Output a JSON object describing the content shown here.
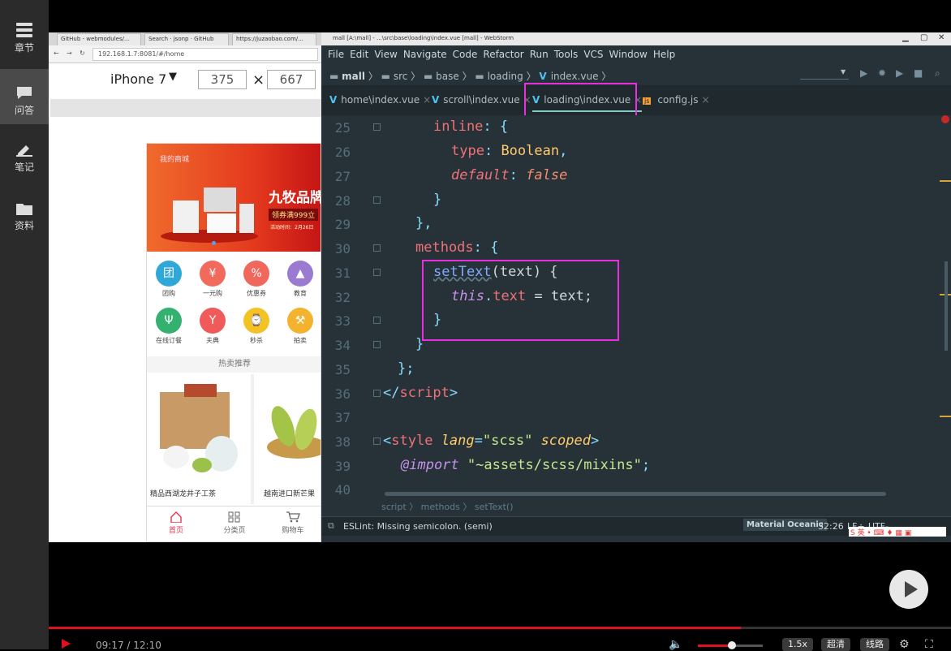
{
  "sidebar": {
    "items": [
      {
        "label": "章节",
        "icon": "list-icon"
      },
      {
        "label": "问答",
        "icon": "chat-icon"
      },
      {
        "label": "笔记",
        "icon": "pencil-icon"
      },
      {
        "label": "资料",
        "icon": "folder-icon"
      }
    ]
  },
  "browser": {
    "tabs": [
      "GitHub - webmodules/...",
      "Search · jsonp · GitHub",
      "https://juzaobao.com/..."
    ],
    "url": "192.168.1.7:8081/#/home",
    "device": "iPhone 7",
    "width": "375",
    "height": "667",
    "times": "×",
    "banner": {
      "logo": "我的商城",
      "title": "九牧品牌",
      "coupon": "领券满999立",
      "note": "活动时间：2月26日"
    },
    "grid": [
      {
        "label": "团购",
        "color": "#2fa8d8"
      },
      {
        "label": "一元购",
        "color": "#f26a5b"
      },
      {
        "label": "优惠券",
        "color": "#f0675c"
      },
      {
        "label": "教育",
        "color": "#9b7ad1"
      },
      {
        "label": "在线订餐",
        "color": "#35b16f"
      },
      {
        "label": "夫典",
        "color": "#f05a5a"
      },
      {
        "label": "秒杀",
        "color": "#f3c326"
      },
      {
        "label": "拍卖",
        "color": "#f3b32e"
      }
    ],
    "hot_title": "热卖推荐",
    "products": [
      "精品西湖龙井子工茶",
      "越南进口新芒果"
    ],
    "tabbar": [
      "首页",
      "分类页",
      "购物车"
    ]
  },
  "ide": {
    "window_title": "mall [A:\\mall] - ...\\src\\base\\loading\\index.vue [mall] - WebStorm",
    "menu": [
      "File",
      "Edit",
      "View",
      "Navigate",
      "Code",
      "Refactor",
      "Run",
      "Tools",
      "VCS",
      "Window",
      "Help"
    ],
    "breadcrumb_nav": [
      "mall",
      "src",
      "base",
      "loading",
      "index.vue"
    ],
    "tabs": [
      "home\\index.vue",
      "scroll\\index.vue",
      "loading\\index.vue",
      "config.js"
    ],
    "line_numbers": [
      "25",
      "26",
      "27",
      "28",
      "29",
      "30",
      "31",
      "32",
      "33",
      "34",
      "35",
      "36",
      "37",
      "38",
      "39",
      "40"
    ],
    "code": {
      "l25": [
        "inline",
        ": {"
      ],
      "l26": [
        "type",
        ": ",
        "Boolean",
        ","
      ],
      "l27": [
        "default",
        ": ",
        "false"
      ],
      "l28": "}",
      "l29": "},",
      "l30": [
        "methods",
        ": {"
      ],
      "l31": [
        "setText",
        "(text) {"
      ],
      "l32": [
        "this",
        ".",
        "text",
        " = text;"
      ],
      "l33": "}",
      "l34": "}",
      "l35": "};",
      "l36": [
        "</",
        "script",
        ">"
      ],
      "l38": [
        "<",
        "style",
        "lang",
        "=",
        "\"scss\"",
        "scoped",
        ">"
      ],
      "l39": [
        "@import",
        "\"~assets/scss/mixins\"",
        ";"
      ]
    },
    "code_breadcrumb": [
      "script",
      "methods",
      "setText()"
    ],
    "status_message": "ESLint: Missing semicolon. (semi)",
    "theme": "Material Oceanic",
    "position": "32:26",
    "line_sep": "LF÷",
    "encoding": "UTF-"
  },
  "player": {
    "time": "09:17 / 12:10",
    "speed": "1.5x",
    "quality": "超清",
    "route": "线路",
    "progress": 0.767
  },
  "colors": {
    "highlight": "#e82fe0",
    "progress": "#e0101e"
  }
}
